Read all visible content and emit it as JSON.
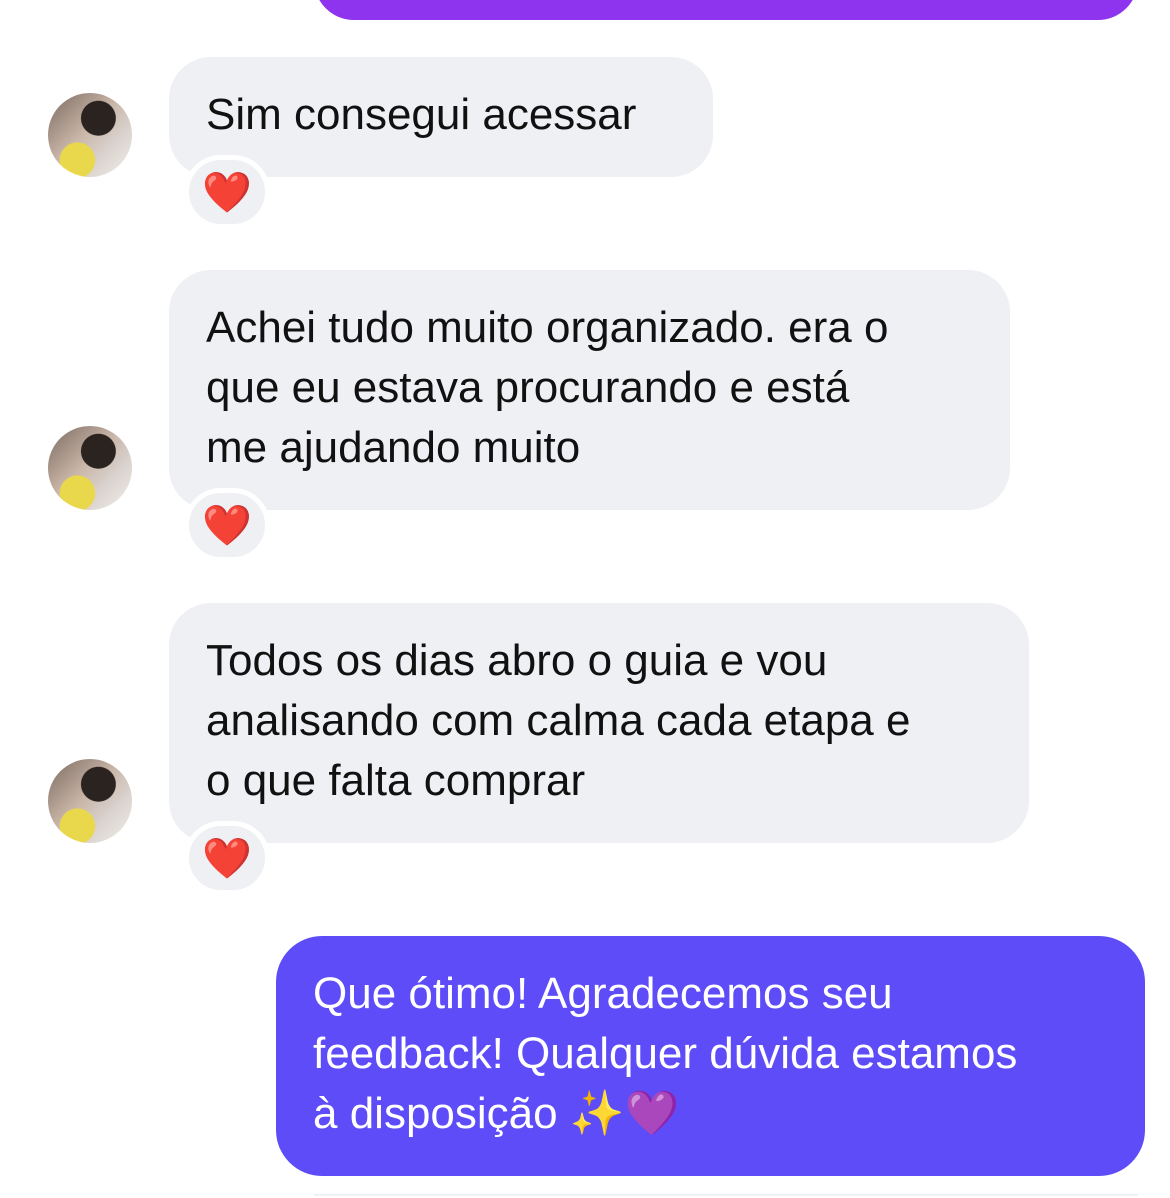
{
  "messages": [
    {
      "sender": "contact",
      "text": "Sim consegui acessar",
      "reaction": "❤️"
    },
    {
      "sender": "contact",
      "text": "Achei tudo muito organizado. era o\nque eu estava procurando e está\nme ajudando muito",
      "reaction": "❤️"
    },
    {
      "sender": "contact",
      "text": "Todos os dias abro o guia e vou\nanalisando com calma cada etapa e\no que falta comprar",
      "reaction": "❤️"
    }
  ],
  "reply": {
    "line1": "Que ótimo! Agradecemos seu",
    "line2": "feedback! Qualquer dúvida estamos",
    "line3": "à disposição",
    "emoji_sparkles": "✨",
    "emoji_heart": "💜"
  },
  "colors": {
    "received_bubble": "#eff0f4",
    "sent_bubble": "#5d4cf8",
    "sent_bubble_top": "#8e34ee",
    "reaction_heart": "#e0182d"
  }
}
